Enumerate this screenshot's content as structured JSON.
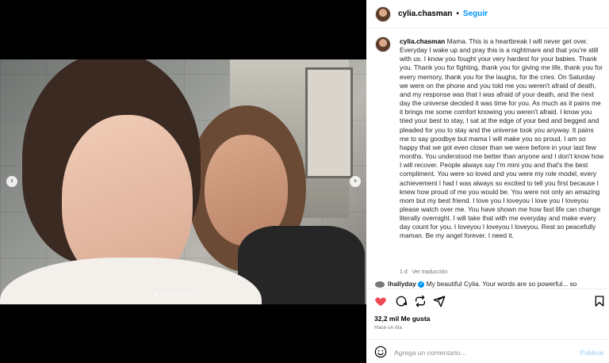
{
  "post": {
    "username": "cylia.chasman",
    "separator": "•",
    "follow_label": "Seguir",
    "caption": "Mama. This is a heartbreak I will never get over. Everyday I wake up and pray this is a nightmare and that you're still with us. I know you fought your very hardest for your babies. Thank you. Thank you for fighting, thank you for giving me life, thank you for every memory, thank you for the laughs, for the cries. On Saturday we were on the phone and you told me you weren't afraid of death, and my response was that I was afraid of your death, and the next day the universe decided it was time for you. As much as it pains me it brings me some comfort knowing you weren't afraid. I know you tried your best to stay, I sat at the edge of your bed and begged and pleaded for you to stay and the universe took you anyway. It pains me to say goodbye but mama I will make you so proud. I am so happy that we got even closer than we were before in your last few months. You understood me better than anyone and I don't know how I will recover. People always say I'm mini you and that's the best compliment. You were so loved and you were my role model, every achievement I had I was always so excited to tell you first because I knew how proud of me you would be. You were not only an amazing mom but my best friend. I love you I loveyou I love you I loveyou please watch over me. You have shown me how fast life can change literally overnight. I will take that with me everyday and make every day count for you. I loveyou I loveyou I loveyou. Rest so peacefully maman. Be my angel forever. I need it.",
    "caption_age": "1 d",
    "translate_label": "Ver traducción",
    "comment_user": "lhallyday",
    "comment_text": "My beautiful Cylia. Your words are so powerful... so",
    "likes": "32,2 mil Me gusta",
    "time": "Hace un día",
    "add_comment_placeholder": "Agrega un comentario...",
    "publish_label": "Publicar"
  },
  "icons": [
    "heart-filled-icon",
    "comment-icon",
    "repost-icon",
    "send-icon",
    "bookmark-icon",
    "emoji-icon",
    "chevron-left-icon",
    "chevron-right-icon",
    "verified-icon"
  ],
  "colors": {
    "like": "#ed4956",
    "link": "#0095f6",
    "publish_disabled": "#9ccdf8"
  }
}
